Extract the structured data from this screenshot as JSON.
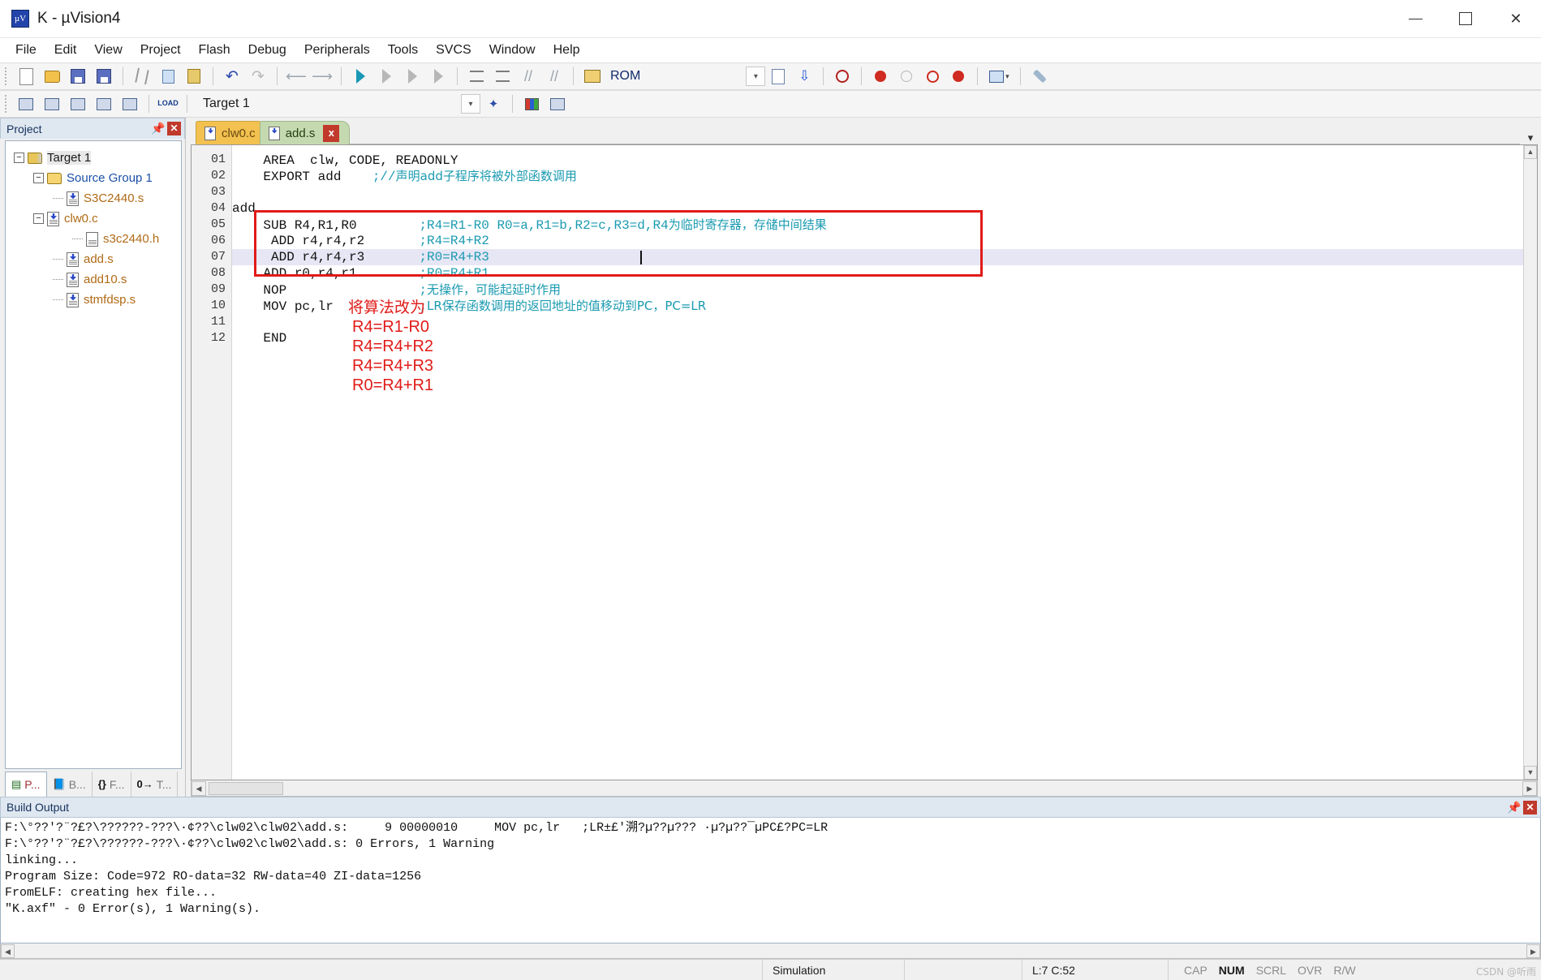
{
  "window": {
    "title": "K  - µVision4",
    "app_icon": "keil-logo-icon",
    "minimize": "minimize-icon",
    "maximize": "maximize-icon",
    "close": "close-icon"
  },
  "menu": [
    "File",
    "Edit",
    "View",
    "Project",
    "Flash",
    "Debug",
    "Peripherals",
    "Tools",
    "SVCS",
    "Window",
    "Help"
  ],
  "toolbar1": {
    "rom_label": "ROM"
  },
  "toolbar2": {
    "target_value": "Target 1"
  },
  "project_panel": {
    "title": "Project",
    "tree": [
      {
        "label": "Target 1",
        "kind": "folder-target",
        "indent": 0,
        "expander": "−",
        "selected": true
      },
      {
        "label": "Source Group 1",
        "kind": "folder",
        "indent": 1,
        "expander": "−",
        "selected": false
      },
      {
        "label": "S3C2440.s",
        "kind": "file-asm",
        "indent": 2,
        "expander": "",
        "selected": false
      },
      {
        "label": "clw0.c",
        "kind": "file-asm",
        "indent": 2,
        "expander": "−",
        "selected": false
      },
      {
        "label": "s3c2440.h",
        "kind": "file-h",
        "indent": 3,
        "expander": "",
        "selected": false
      },
      {
        "label": "add.s",
        "kind": "file-asm",
        "indent": 2,
        "expander": "",
        "selected": false
      },
      {
        "label": "add10.s",
        "kind": "file-asm",
        "indent": 2,
        "expander": "",
        "selected": false
      },
      {
        "label": "stmfdsp.s",
        "kind": "file-asm",
        "indent": 2,
        "expander": "",
        "selected": false
      }
    ],
    "tabs": [
      {
        "label": "P...",
        "icon": "project-icon",
        "active": true
      },
      {
        "label": "B...",
        "icon": "books-icon",
        "active": false
      },
      {
        "label": "F...",
        "icon": "braces-icon",
        "active": false
      },
      {
        "label": "T...",
        "icon": "templates-icon",
        "active": false
      }
    ]
  },
  "editor": {
    "tabs": [
      {
        "label": "clw0.c",
        "active": false,
        "closable": false
      },
      {
        "label": "add.s",
        "active": true,
        "closable": true,
        "close_label": "x"
      }
    ],
    "line_numbers": [
      "01",
      "02",
      "03",
      "04",
      "05",
      "06",
      "07",
      "08",
      "09",
      "10",
      "11",
      "12"
    ],
    "lines": [
      {
        "n": "01",
        "code": "    AREA  clw, CODE, READONLY",
        "comment": "",
        "comment_cn": "",
        "highlight": false
      },
      {
        "n": "02",
        "code": "    EXPORT add",
        "comment": "    ;//",
        "comment_cn": "声明add子程序将被外部函数调用",
        "highlight": false
      },
      {
        "n": "03",
        "code": "",
        "comment": "",
        "comment_cn": "",
        "highlight": false
      },
      {
        "n": "04",
        "code": "add",
        "comment": "",
        "comment_cn": "",
        "highlight": false
      },
      {
        "n": "05",
        "code": "    SUB R4,R1,R0",
        "comment": "        ;R4=R1-R0 R0=a,R1=b,R2=c,R3=d,R4",
        "comment_cn": "为临时寄存器，存储中间结果",
        "highlight": false
      },
      {
        "n": "06",
        "code": "     ADD r4,r4,r2",
        "comment": "       ;R4=R4+R2",
        "comment_cn": "",
        "highlight": false
      },
      {
        "n": "07",
        "code": "     ADD r4,r4,r3",
        "comment": "       ;R0=R4+R3",
        "comment_cn": "",
        "highlight": true
      },
      {
        "n": "08",
        "code": "    ADD r0,r4,r1",
        "comment": "        ;R0=R4+R1",
        "comment_cn": "",
        "highlight": false
      },
      {
        "n": "09",
        "code": "    NOP",
        "comment": "                 ;",
        "comment_cn": "无操作，可能起延时作用",
        "highlight": false
      },
      {
        "n": "10",
        "code": "    MOV pc,lr",
        "comment": "           ;",
        "comment_cn": "LR保存函数调用的返回地址的值移动到PC，PC=LR",
        "highlight": false
      },
      {
        "n": "11",
        "code": "",
        "comment": "",
        "comment_cn": "",
        "highlight": false
      },
      {
        "n": "12",
        "code": "    END",
        "comment": "",
        "comment_cn": "",
        "highlight": false
      }
    ],
    "annotation": {
      "heading": "将算法改为",
      "lines": [
        "R4=R1-R0",
        "R4=R4+R2",
        "R4=R4+R3",
        "R0=R4+R1"
      ],
      "color": "#e01b18"
    }
  },
  "build_output": {
    "title": "Build Output",
    "lines": [
      "F:\\°??'?¨?£?\\??????-???\\·¢??\\clw02\\clw02\\add.s:     9 00000010     MOV pc,lr   ;LR±£'溯?µ??µ??? ·µ?µ??¯µPC£?PC=LR",
      "F:\\°??'?¨?£?\\??????-???\\·¢??\\clw02\\clw02\\add.s: 0 Errors, 1 Warning",
      "linking...",
      "Program Size: Code=972 RO-data=32 RW-data=40 ZI-data=1256",
      "FromELF: creating hex file...",
      "\"K.axf\" - 0 Error(s), 1 Warning(s)."
    ]
  },
  "status_bar": {
    "mode": "Simulation",
    "position": "L:7 C:52",
    "indicators": [
      {
        "label": "CAP",
        "on": false
      },
      {
        "label": "NUM",
        "on": true
      },
      {
        "label": "SCRL",
        "on": false
      },
      {
        "label": "OVR",
        "on": false
      },
      {
        "label": "R/W",
        "on": false
      }
    ],
    "watermark": "CSDN @听雨"
  }
}
